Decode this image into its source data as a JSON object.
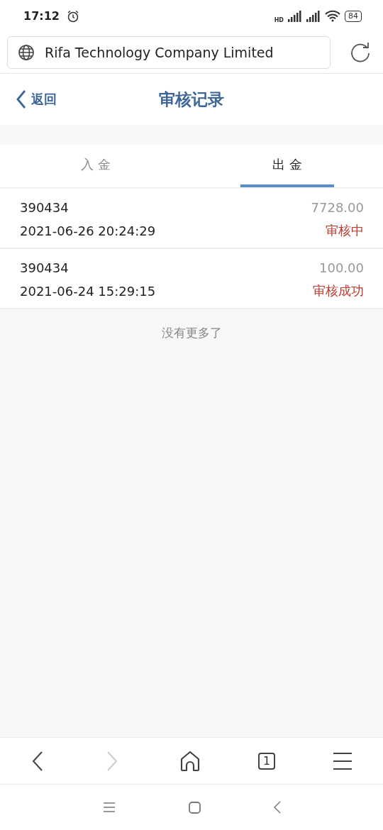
{
  "status_bar": {
    "time": "17:12",
    "network": "HD",
    "battery": "84"
  },
  "address_bar": {
    "title": "Rifa Technology Company Limited"
  },
  "header": {
    "back": "返回",
    "title": "审核记录"
  },
  "tabs": [
    {
      "label": "入 金",
      "selected": false
    },
    {
      "label": "出 金",
      "selected": true
    }
  ],
  "records": [
    {
      "id": "390434",
      "amount": "7728.00",
      "time": "2021-06-26 20:24:29",
      "status": "审核中"
    },
    {
      "id": "390434",
      "amount": "100.00",
      "time": "2021-06-24 15:29:15",
      "status": "审核成功"
    }
  ],
  "end_note": "没有更多了",
  "toolbar": {
    "back_disabled": false,
    "forward_disabled": true,
    "tab_count": "1"
  }
}
